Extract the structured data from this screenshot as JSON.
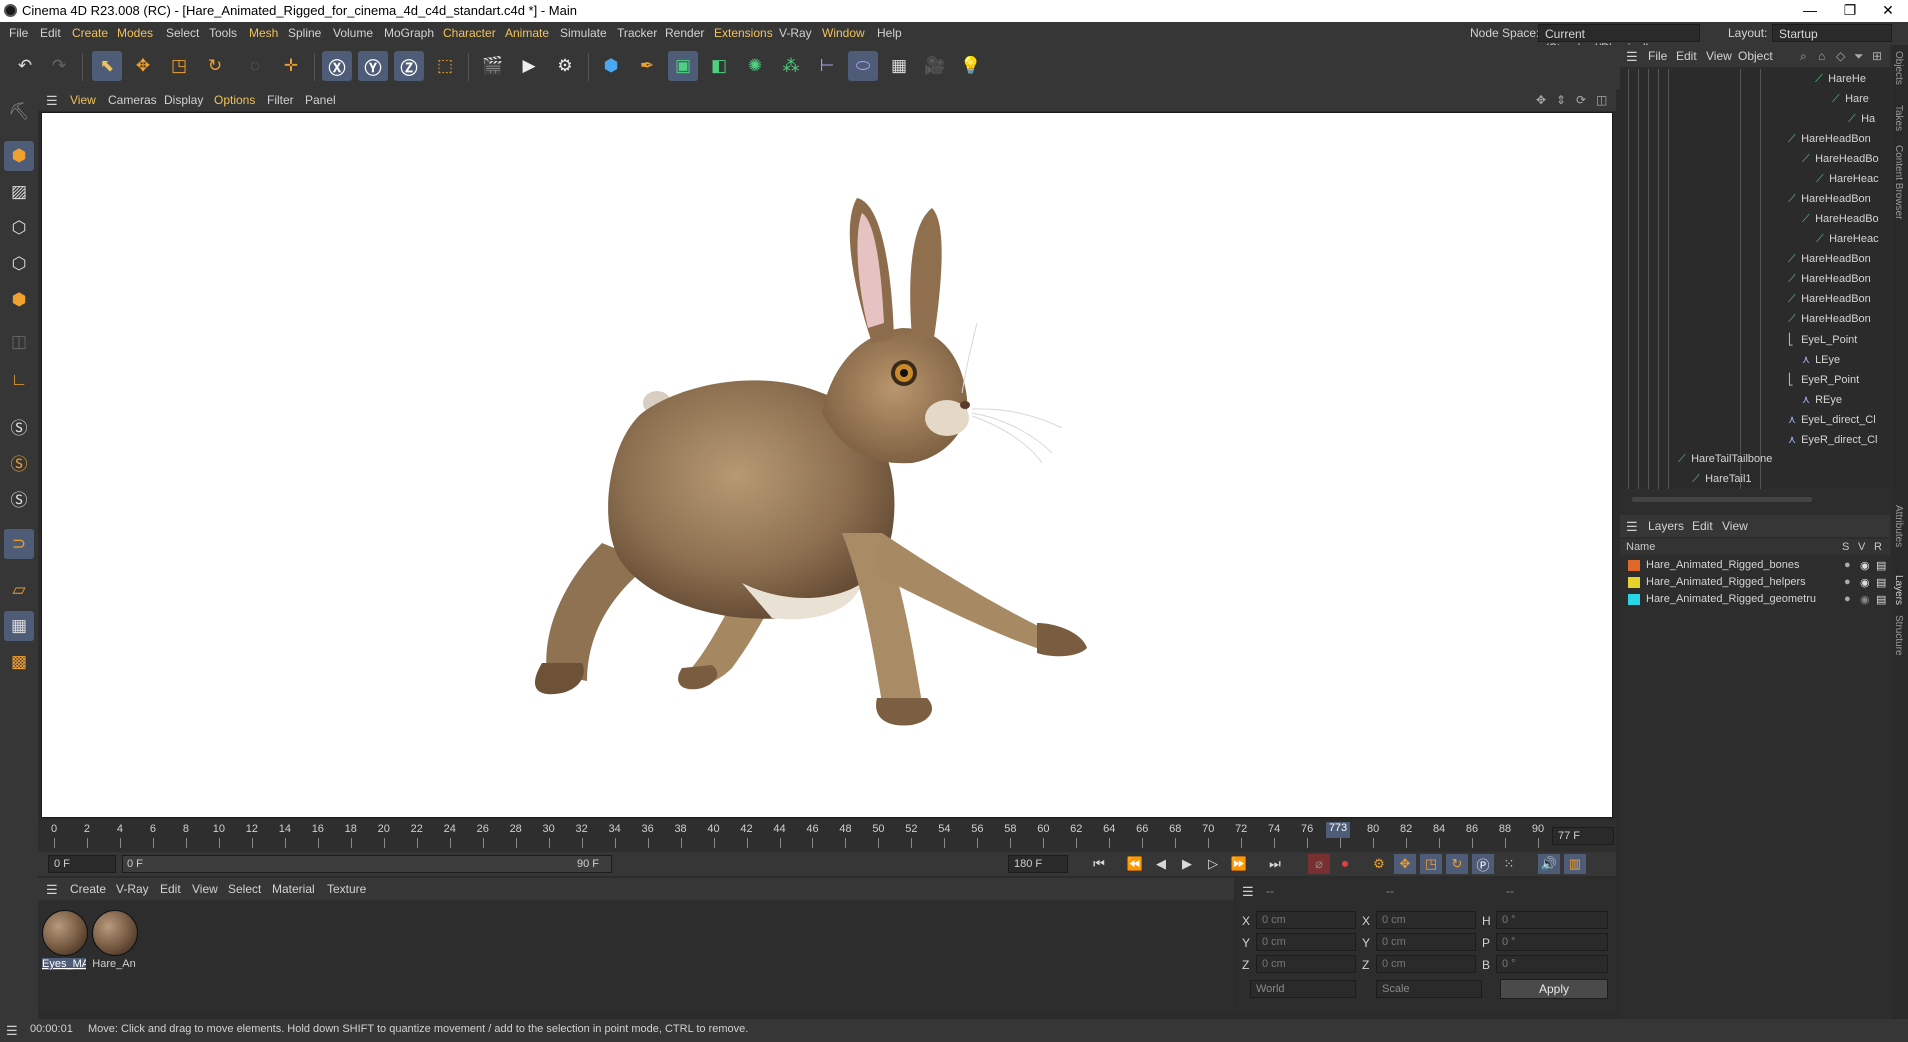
{
  "window": {
    "title": "Cinema 4D R23.008 (RC) - [Hare_Animated_Rigged_for_cinema_4d_c4d_standart.c4d *] - Main",
    "minimize": "—",
    "maximize": "❐",
    "close": "✕"
  },
  "menubar": {
    "items": [
      "File",
      "Edit",
      "Create",
      "Modes",
      "Select",
      "Tools",
      "Mesh",
      "Spline",
      "Volume",
      "MoGraph",
      "Character",
      "Animate",
      "Simulate",
      "Tracker",
      "Render",
      "Extensions",
      "V-Ray",
      "Window",
      "Help"
    ],
    "node_space_label": "Node Space:",
    "node_space_value": "Current (Standard/Physical)",
    "layout_label": "Layout:",
    "layout_value": "Startup"
  },
  "viewport": {
    "menu": [
      "View",
      "Cameras",
      "Display",
      "Options",
      "Filter",
      "Panel"
    ]
  },
  "timeline": {
    "ticks": [
      "0",
      "2",
      "4",
      "6",
      "8",
      "10",
      "12",
      "14",
      "16",
      "18",
      "20",
      "22",
      "24",
      "26",
      "28",
      "30",
      "32",
      "34",
      "36",
      "38",
      "40",
      "42",
      "44",
      "46",
      "48",
      "50",
      "52",
      "54",
      "56",
      "58",
      "60",
      "62",
      "64",
      "66",
      "68",
      "70",
      "72",
      "74",
      "76",
      "78",
      "80",
      "82",
      "84",
      "86",
      "88",
      "90"
    ],
    "playhead_label": "773",
    "current_frame": "77 F",
    "start_field": "0 F",
    "range_start": "0 F",
    "range_end": "90 F",
    "end_field": "180 F"
  },
  "materials": {
    "menu": [
      "Create",
      "V-Ray",
      "Edit",
      "View",
      "Select",
      "Material",
      "Texture"
    ],
    "items": [
      {
        "label": "Eyes_MA"
      },
      {
        "label": "Hare_An"
      }
    ]
  },
  "coordinates": {
    "header": [
      "--",
      "--",
      "--"
    ],
    "rows": [
      {
        "a": "X",
        "av": "0 cm",
        "b": "X",
        "bv": "0 cm",
        "c": "H",
        "cv": "0 °"
      },
      {
        "a": "Y",
        "av": "0 cm",
        "b": "Y",
        "bv": "0 cm",
        "c": "P",
        "cv": "0 °"
      },
      {
        "a": "Z",
        "av": "0 cm",
        "b": "Z",
        "bv": "0 cm",
        "c": "B",
        "cv": "0 °"
      }
    ],
    "space": "World",
    "mode": "Scale",
    "apply": "Apply"
  },
  "objects": {
    "menu": [
      "File",
      "Edit",
      "View",
      "Object"
    ],
    "rows": [
      "HareHe",
      "Hare",
      "Ha",
      "HareHeadBon",
      "HareHeadBo",
      "HareHeac",
      "HareHeadBon",
      "HareHeadBo",
      "HareHeac",
      "HareHeadBon",
      "HareHeadBon",
      "HareHeadBon",
      "HareHeadBon",
      "EyeL_Point",
      "LEye",
      "EyeR_Point",
      "REye",
      "EyeL_direct_Cl",
      "EyeR_direct_Cl",
      "HareTailTailbone",
      "HareTail1"
    ]
  },
  "layers": {
    "menu": [
      "Layers",
      "Edit",
      "View"
    ],
    "col_name": "Name",
    "col_s": "S",
    "col_v": "V",
    "col_r": "R",
    "rows": [
      {
        "name": "Hare_Animated_Rigged_bones",
        "color": "#e0672a"
      },
      {
        "name": "Hare_Animated_Rigged_helpers",
        "color": "#e6d22a"
      },
      {
        "name": "Hare_Animated_Rigged_geometru",
        "color": "#2ad6e6"
      }
    ]
  },
  "side_tabs": [
    "Objects",
    "Takes",
    "Content Browser",
    "Attributes",
    "Layers",
    "Structure"
  ],
  "status": {
    "time": "00:00:01",
    "message": "Move: Click and drag to move elements. Hold down SHIFT to quantize movement / add to the selection in point mode, CTRL to remove."
  }
}
